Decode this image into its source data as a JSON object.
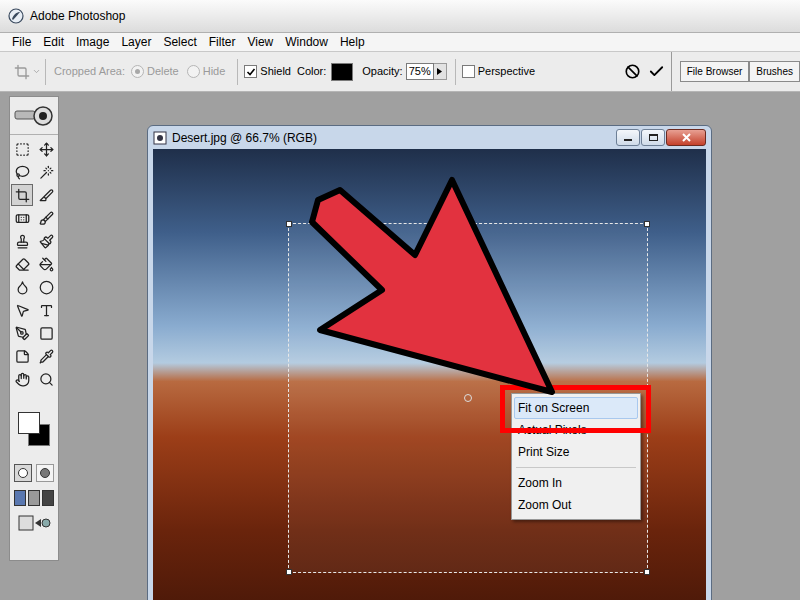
{
  "window": {
    "title": "Adobe Photoshop"
  },
  "menu": [
    "File",
    "Edit",
    "Image",
    "Layer",
    "Select",
    "Filter",
    "View",
    "Window",
    "Help"
  ],
  "options_bar": {
    "cropped_area_label": "Cropped Area:",
    "cropped_area_disabled": true,
    "radios": [
      {
        "label": "Delete",
        "selected": true,
        "disabled": true
      },
      {
        "label": "Hide",
        "selected": false,
        "disabled": true
      }
    ],
    "shield": {
      "label": "Shield",
      "checked": true
    },
    "color_label": "Color:",
    "color": "#000000",
    "opacity_label": "Opacity:",
    "opacity": "75%",
    "perspective": {
      "label": "Perspective",
      "checked": false
    }
  },
  "palette_tabs": [
    {
      "label": "File Browser"
    },
    {
      "label": "Brushes"
    }
  ],
  "toolbox": {
    "tools": [
      {
        "selected": false
      },
      {
        "selected": false
      },
      {
        "selected": false
      },
      {
        "selected": false
      },
      {
        "selected": true
      },
      {
        "selected": false
      },
      {
        "selected": false
      },
      {
        "selected": false
      },
      {
        "selected": false
      },
      {
        "selected": false
      },
      {
        "selected": false
      },
      {
        "selected": false
      },
      {
        "selected": false
      },
      {
        "selected": false
      },
      {
        "selected": false
      },
      {
        "selected": false
      },
      {
        "selected": false
      },
      {
        "selected": false
      },
      {
        "selected": false
      },
      {
        "selected": false
      },
      {
        "selected": false
      },
      {
        "selected": false
      }
    ],
    "foreground": "#ffffff",
    "background": "#000000"
  },
  "document": {
    "title": "Desert.jpg @ 66.7% (RGB)"
  },
  "context_menu": {
    "groups": [
      [
        {
          "label": "Fit on Screen",
          "selected": true
        },
        {
          "label": "Actual Pixels",
          "selected": false
        },
        {
          "label": "Print Size",
          "selected": false
        }
      ],
      [
        {
          "label": "Zoom In",
          "selected": false
        },
        {
          "label": "Zoom Out",
          "selected": false
        }
      ]
    ]
  }
}
